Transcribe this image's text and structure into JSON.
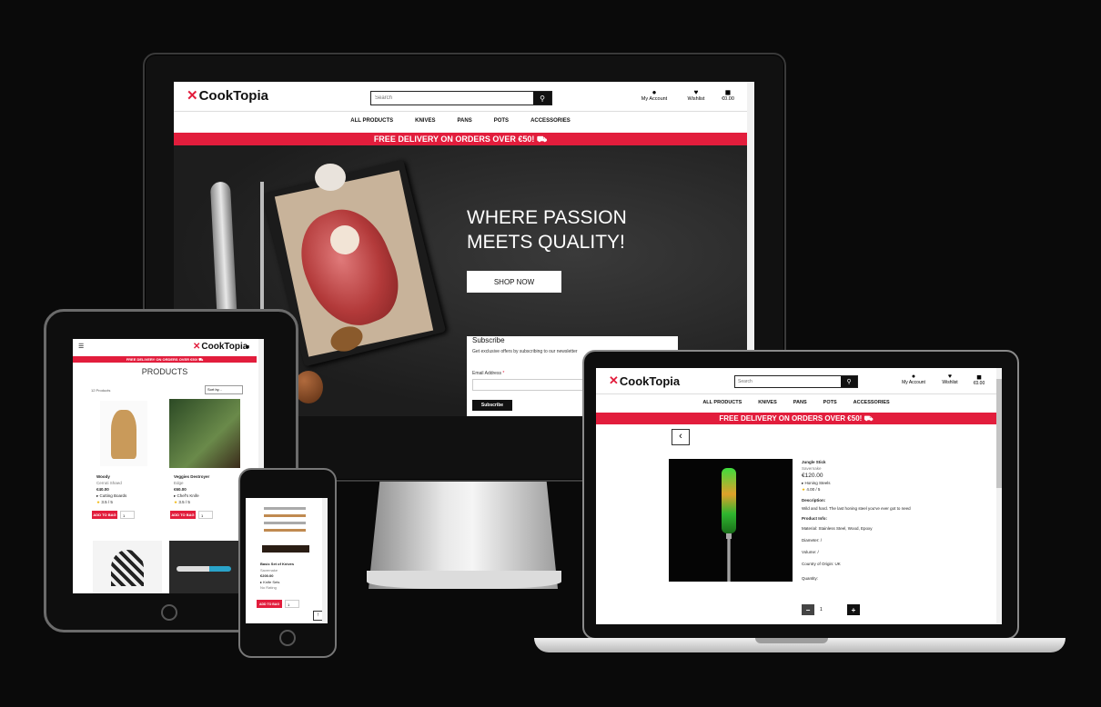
{
  "brand": {
    "name": "CookTopia",
    "accent": "#e21d3c"
  },
  "header": {
    "search_placeholder": "Search",
    "account_label": "My Account",
    "wishlist_label": "Wishlist",
    "cart_total": "€0.00"
  },
  "nav": [
    "ALL PRODUCTS",
    "KNIVES",
    "PANS",
    "POTS",
    "ACCESSORIES"
  ],
  "promo": "FREE DELIVERY ON ORDERS OVER €50! ⛟",
  "hero": {
    "headline_1": "WHERE PASSION",
    "headline_2": "MEETS QUALITY!",
    "cta": "SHOP NOW"
  },
  "subscribe": {
    "title": "Subscribe",
    "text": "Get exclusive offers by subscribing to our newsletter",
    "email_label": "Email Address",
    "required_mark": "*",
    "button": "Subscribe"
  },
  "tablet": {
    "menu_icon": "☰",
    "page_title": "PRODUCTS",
    "count": "12 Products",
    "sort": "Sort by...",
    "products": [
      {
        "name": "Woody",
        "brand": "Cerruti Shaed",
        "price": "€40.00",
        "category": "Cutting Boards",
        "rating": "3.5 / 5",
        "add": "ADD TO BAG",
        "qty": "1"
      },
      {
        "name": "Veggies Destroyer",
        "brand": "Edge",
        "price": "€60.00",
        "category": "Chef's Knife",
        "rating": "3.5 / 5",
        "add": "ADD TO BAG",
        "qty": "1"
      }
    ]
  },
  "phone": {
    "product": {
      "name": "Basic Set of Knives",
      "brand": "Savernake",
      "price": "€200.00",
      "category": "Knife Sets",
      "rating": "No Rating",
      "add": "ADD TO BAG",
      "qty": "1"
    }
  },
  "laptop": {
    "back_icon": "‹",
    "product_name": "Jungle Stick",
    "brand": "Savernake",
    "price": "€120.00",
    "category": "Honing Steels",
    "rating": "4.00 / 5",
    "description_label": "Description:",
    "description": "Wild and hard. The last honing steel you've ever got to need",
    "info_label": "Product Info:",
    "material": "Material: Stainless Steel, Wood, Epoxy",
    "diameter": "Diameter: /",
    "volume": "Volume: /",
    "origin": "Country of Origin: UK",
    "quantity_label": "Quantity:",
    "qty": "1",
    "minus": "−",
    "plus": "+"
  }
}
